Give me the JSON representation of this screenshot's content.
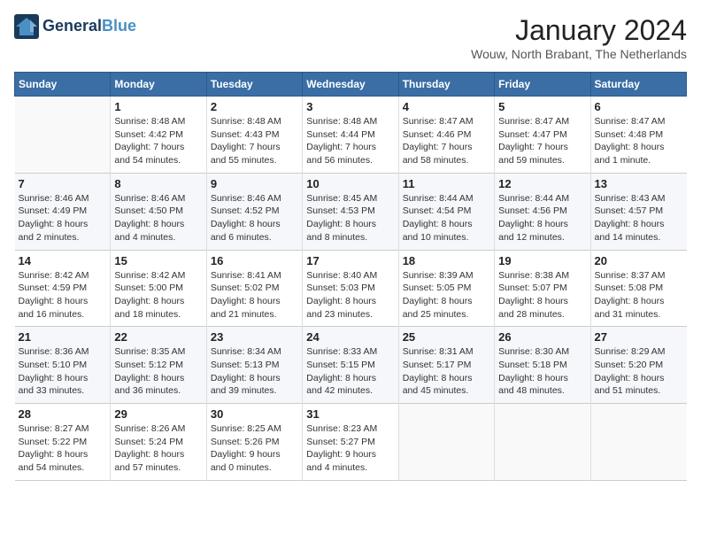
{
  "header": {
    "logo_line1": "General",
    "logo_line2": "Blue",
    "month": "January 2024",
    "location": "Wouw, North Brabant, The Netherlands"
  },
  "weekdays": [
    "Sunday",
    "Monday",
    "Tuesday",
    "Wednesday",
    "Thursday",
    "Friday",
    "Saturday"
  ],
  "weeks": [
    [
      {
        "num": "",
        "info": ""
      },
      {
        "num": "1",
        "info": "Sunrise: 8:48 AM\nSunset: 4:42 PM\nDaylight: 7 hours\nand 54 minutes."
      },
      {
        "num": "2",
        "info": "Sunrise: 8:48 AM\nSunset: 4:43 PM\nDaylight: 7 hours\nand 55 minutes."
      },
      {
        "num": "3",
        "info": "Sunrise: 8:48 AM\nSunset: 4:44 PM\nDaylight: 7 hours\nand 56 minutes."
      },
      {
        "num": "4",
        "info": "Sunrise: 8:47 AM\nSunset: 4:46 PM\nDaylight: 7 hours\nand 58 minutes."
      },
      {
        "num": "5",
        "info": "Sunrise: 8:47 AM\nSunset: 4:47 PM\nDaylight: 7 hours\nand 59 minutes."
      },
      {
        "num": "6",
        "info": "Sunrise: 8:47 AM\nSunset: 4:48 PM\nDaylight: 8 hours\nand 1 minute."
      }
    ],
    [
      {
        "num": "7",
        "info": "Sunrise: 8:46 AM\nSunset: 4:49 PM\nDaylight: 8 hours\nand 2 minutes."
      },
      {
        "num": "8",
        "info": "Sunrise: 8:46 AM\nSunset: 4:50 PM\nDaylight: 8 hours\nand 4 minutes."
      },
      {
        "num": "9",
        "info": "Sunrise: 8:46 AM\nSunset: 4:52 PM\nDaylight: 8 hours\nand 6 minutes."
      },
      {
        "num": "10",
        "info": "Sunrise: 8:45 AM\nSunset: 4:53 PM\nDaylight: 8 hours\nand 8 minutes."
      },
      {
        "num": "11",
        "info": "Sunrise: 8:44 AM\nSunset: 4:54 PM\nDaylight: 8 hours\nand 10 minutes."
      },
      {
        "num": "12",
        "info": "Sunrise: 8:44 AM\nSunset: 4:56 PM\nDaylight: 8 hours\nand 12 minutes."
      },
      {
        "num": "13",
        "info": "Sunrise: 8:43 AM\nSunset: 4:57 PM\nDaylight: 8 hours\nand 14 minutes."
      }
    ],
    [
      {
        "num": "14",
        "info": "Sunrise: 8:42 AM\nSunset: 4:59 PM\nDaylight: 8 hours\nand 16 minutes."
      },
      {
        "num": "15",
        "info": "Sunrise: 8:42 AM\nSunset: 5:00 PM\nDaylight: 8 hours\nand 18 minutes."
      },
      {
        "num": "16",
        "info": "Sunrise: 8:41 AM\nSunset: 5:02 PM\nDaylight: 8 hours\nand 21 minutes."
      },
      {
        "num": "17",
        "info": "Sunrise: 8:40 AM\nSunset: 5:03 PM\nDaylight: 8 hours\nand 23 minutes."
      },
      {
        "num": "18",
        "info": "Sunrise: 8:39 AM\nSunset: 5:05 PM\nDaylight: 8 hours\nand 25 minutes."
      },
      {
        "num": "19",
        "info": "Sunrise: 8:38 AM\nSunset: 5:07 PM\nDaylight: 8 hours\nand 28 minutes."
      },
      {
        "num": "20",
        "info": "Sunrise: 8:37 AM\nSunset: 5:08 PM\nDaylight: 8 hours\nand 31 minutes."
      }
    ],
    [
      {
        "num": "21",
        "info": "Sunrise: 8:36 AM\nSunset: 5:10 PM\nDaylight: 8 hours\nand 33 minutes."
      },
      {
        "num": "22",
        "info": "Sunrise: 8:35 AM\nSunset: 5:12 PM\nDaylight: 8 hours\nand 36 minutes."
      },
      {
        "num": "23",
        "info": "Sunrise: 8:34 AM\nSunset: 5:13 PM\nDaylight: 8 hours\nand 39 minutes."
      },
      {
        "num": "24",
        "info": "Sunrise: 8:33 AM\nSunset: 5:15 PM\nDaylight: 8 hours\nand 42 minutes."
      },
      {
        "num": "25",
        "info": "Sunrise: 8:31 AM\nSunset: 5:17 PM\nDaylight: 8 hours\nand 45 minutes."
      },
      {
        "num": "26",
        "info": "Sunrise: 8:30 AM\nSunset: 5:18 PM\nDaylight: 8 hours\nand 48 minutes."
      },
      {
        "num": "27",
        "info": "Sunrise: 8:29 AM\nSunset: 5:20 PM\nDaylight: 8 hours\nand 51 minutes."
      }
    ],
    [
      {
        "num": "28",
        "info": "Sunrise: 8:27 AM\nSunset: 5:22 PM\nDaylight: 8 hours\nand 54 minutes."
      },
      {
        "num": "29",
        "info": "Sunrise: 8:26 AM\nSunset: 5:24 PM\nDaylight: 8 hours\nand 57 minutes."
      },
      {
        "num": "30",
        "info": "Sunrise: 8:25 AM\nSunset: 5:26 PM\nDaylight: 9 hours\nand 0 minutes."
      },
      {
        "num": "31",
        "info": "Sunrise: 8:23 AM\nSunset: 5:27 PM\nDaylight: 9 hours\nand 4 minutes."
      },
      {
        "num": "",
        "info": ""
      },
      {
        "num": "",
        "info": ""
      },
      {
        "num": "",
        "info": ""
      }
    ]
  ]
}
